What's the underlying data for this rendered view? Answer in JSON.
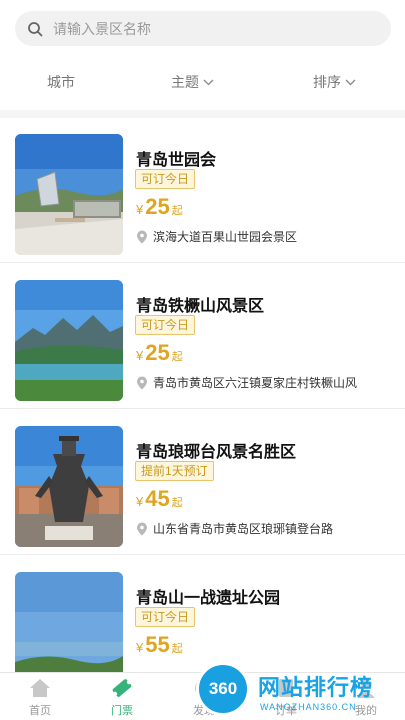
{
  "search": {
    "placeholder": "请输入景区名称"
  },
  "filters": [
    {
      "label": "城市"
    },
    {
      "label": "主题"
    },
    {
      "label": "排序"
    }
  ],
  "spots": [
    {
      "title": "青岛世园会",
      "tag": "可订今日",
      "currency": "¥",
      "price": "25",
      "unit": "起",
      "address": "滨海大道百果山世园会景区"
    },
    {
      "title": "青岛铁橛山风景区",
      "tag": "可订今日",
      "currency": "¥",
      "price": "25",
      "unit": "起",
      "address": "青岛市黄岛区六汪镇夏家庄村铁橛山风"
    },
    {
      "title": "青岛琅琊台风景名胜区",
      "tag": "提前1天预订",
      "currency": "¥",
      "price": "45",
      "unit": "起",
      "address": "山东省青岛市黄岛区琅琊镇登台路"
    },
    {
      "title": "青岛山一战遗址公园",
      "tag": "可订今日",
      "currency": "¥",
      "price": "55",
      "unit": "起",
      "address": ""
    }
  ],
  "tabbar": {
    "items": [
      {
        "label": "首页",
        "icon": "home-icon"
      },
      {
        "label": "门票",
        "icon": "ticket-icon"
      },
      {
        "label": "发现",
        "icon": "discover-icon"
      },
      {
        "label": "订单",
        "icon": "order-icon"
      },
      {
        "label": "我的",
        "icon": "user-icon"
      }
    ],
    "active_color": "#34b37a",
    "inactive_color": "#999999"
  },
  "watermark": {
    "badge": "360",
    "text": "网站排行榜",
    "sub": "WANGZHAN360.CN"
  },
  "colors": {
    "price": "#e0a420",
    "tag_border": "#e8c46a",
    "tag_bg": "#fdf6dc"
  }
}
